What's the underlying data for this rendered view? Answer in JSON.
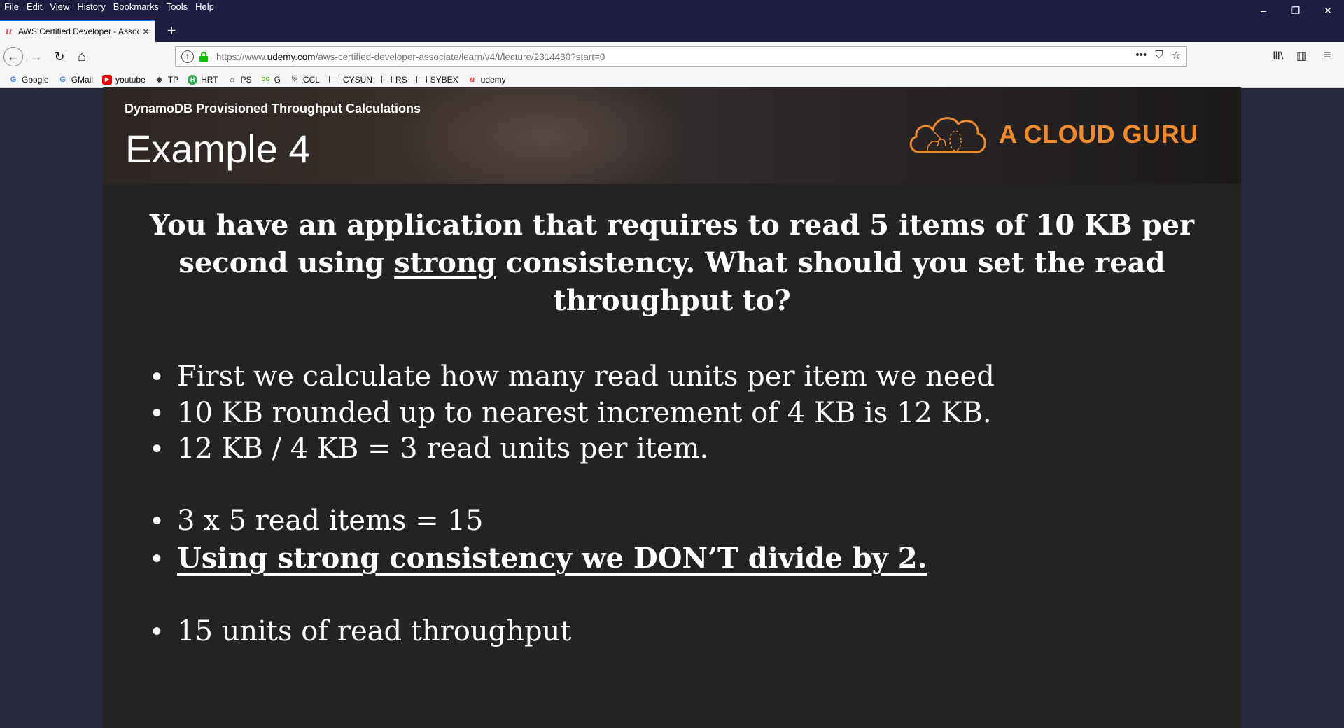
{
  "menu": [
    "File",
    "Edit",
    "View",
    "History",
    "Bookmarks",
    "Tools",
    "Help"
  ],
  "window_controls": {
    "minimize": "–",
    "restore": "❐",
    "close": "✕"
  },
  "tab": {
    "title": "AWS Certified Developer - Associate",
    "favicon": "u",
    "close": "×"
  },
  "new_tab": "+",
  "nav": {
    "back": "←",
    "forward": "→",
    "reload": "↻",
    "home": "⌂"
  },
  "url": {
    "prefix": "https://www.",
    "domain": "udemy.com",
    "path": "/aws-certified-developer-associate/learn/v4/t/lecture/2314430?start=0",
    "info_icon": "i",
    "actions": [
      "•••",
      "⛉",
      "☆"
    ]
  },
  "toolbar_right": [
    "Ⅲ\\",
    "▥",
    "≡"
  ],
  "bookmarks": [
    {
      "label": "Google",
      "icon": "google-icon",
      "glyph": "G"
    },
    {
      "label": "GMail",
      "icon": "google-icon",
      "glyph": "G"
    },
    {
      "label": "youtube",
      "icon": "youtube-icon",
      "glyph": "▶"
    },
    {
      "label": "TP",
      "icon": "tp-icon",
      "glyph": "◈"
    },
    {
      "label": "HRT",
      "icon": "hrt-icon",
      "glyph": "H"
    },
    {
      "label": "PS",
      "icon": "ps-icon",
      "glyph": "⌂"
    },
    {
      "label": "G",
      "icon": "dg-icon",
      "glyph": "DG"
    },
    {
      "label": "CCL",
      "icon": "ccl-icon",
      "glyph": "⛨"
    },
    {
      "label": "CYSUN",
      "icon": "folder-icon",
      "glyph": ""
    },
    {
      "label": "RS",
      "icon": "folder-icon",
      "glyph": ""
    },
    {
      "label": "SYBEX",
      "icon": "folder-icon",
      "glyph": ""
    },
    {
      "label": "udemy",
      "icon": "udemy-icon",
      "glyph": "u"
    }
  ],
  "slide": {
    "subtitle": "DynamoDB Provisioned Throughput Calculations",
    "title": "Example 4",
    "logo_text": "A CLOUD GURU",
    "question_pre": "You have an application that requires to read 5 items of 10 KB per second using ",
    "question_strong": "strong",
    "question_post": " consistency. What should you set the read throughput to?",
    "bullets": [
      {
        "text": "First we calculate how many read units per item we need",
        "emphasis": false
      },
      {
        "text": "10 KB rounded up to nearest increment of 4 KB is 12 KB.",
        "emphasis": false
      },
      {
        "text": "12 KB / 4 KB = 3 read units per item.",
        "emphasis": false
      },
      {
        "text": "3 x 5 read items = 15",
        "emphasis": false
      },
      {
        "text": "Using strong consistency we DON’T divide by 2.",
        "emphasis": true
      },
      {
        "text": "15 units of read throughput",
        "emphasis": false
      }
    ],
    "bullet_glyph": "•"
  },
  "colors": {
    "accent": "#0a84ff",
    "brand_orange": "#f18a2c",
    "udemy_red": "#ec5252",
    "lock_green": "#12bc00"
  }
}
